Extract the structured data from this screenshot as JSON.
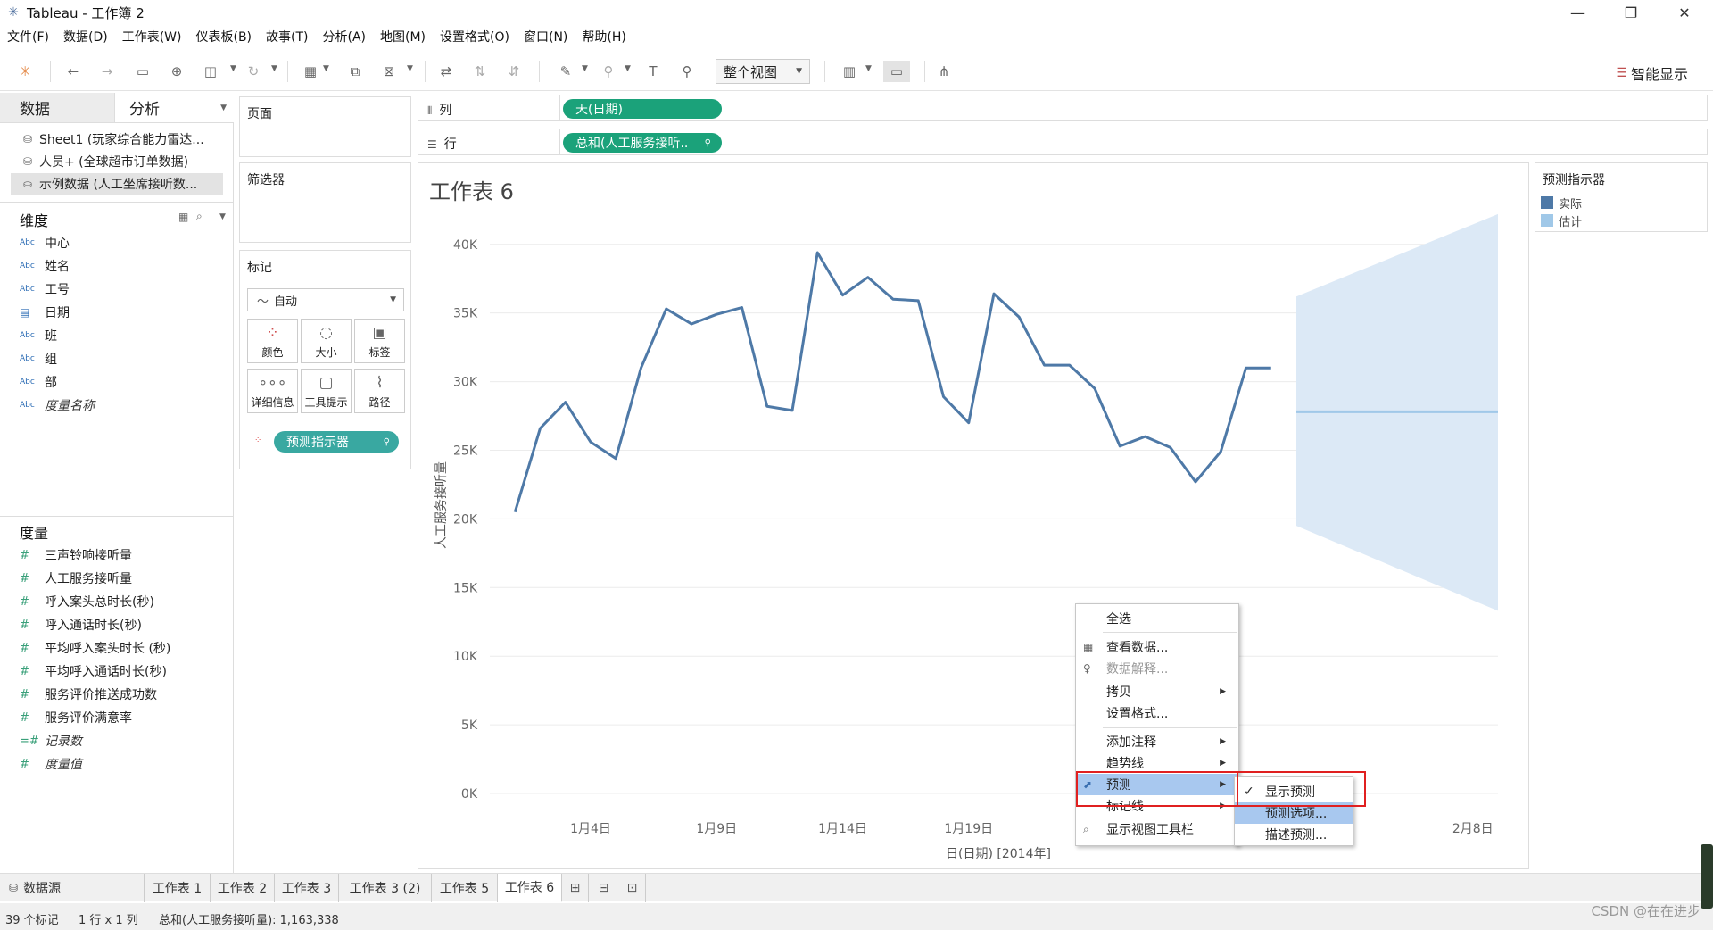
{
  "window": {
    "title": "Tableau - 工作簿 2",
    "min_label": "—",
    "max_label": "❐",
    "close_label": "✕"
  },
  "menu": [
    "文件(F)",
    "数据(D)",
    "工作表(W)",
    "仪表板(B)",
    "故事(T)",
    "分析(A)",
    "地图(M)",
    "设置格式(O)",
    "窗口(N)",
    "帮助(H)"
  ],
  "toolbar": {
    "fit_view": "整个视图",
    "show_me": "智能显示"
  },
  "data_pane": {
    "tab_data": "数据",
    "tab_analysis": "分析",
    "datasources": [
      "Sheet1 (玩家综合能力雷达...",
      "人员+ (全球超市订单数据)",
      "示例数据 (人工坐席接听数..."
    ],
    "dimensions_header": "维度",
    "dimensions": [
      {
        "icon": "Abc",
        "name": "中心"
      },
      {
        "icon": "Abc",
        "name": "姓名"
      },
      {
        "icon": "Abc",
        "name": "工号"
      },
      {
        "icon": "cal",
        "name": "日期"
      },
      {
        "icon": "Abc",
        "name": "班"
      },
      {
        "icon": "Abc",
        "name": "组"
      },
      {
        "icon": "Abc",
        "name": "部"
      },
      {
        "icon": "Abc",
        "name": "度量名称"
      }
    ],
    "measures_header": "度量",
    "measures": [
      "三声铃响接听量",
      "人工服务接听量",
      "呼入案头总时长(秒)",
      "呼入通话时长(秒)",
      "平均呼入案头时长 (秒)",
      "平均呼入通话时长(秒)",
      "服务评价推送成功数",
      "服务评价满意率",
      "记录数",
      "度量值"
    ]
  },
  "shelves": {
    "pages": "页面",
    "filters": "筛选器",
    "marks": "标记",
    "marks_type": "自动",
    "mark_buttons": [
      "颜色",
      "大小",
      "标签",
      "详细信息",
      "工具提示",
      "路径"
    ],
    "marks_pill": "预测指示器",
    "columns_label": "列",
    "columns_pill": "天(日期)",
    "rows_label": "行",
    "rows_pill": "总和(人工服务接听.."
  },
  "sheet": {
    "title": "工作表 6"
  },
  "chart_data": {
    "type": "line",
    "xlabel": "日(日期) [2014年]",
    "ylabel": "人工服务接听量",
    "ylim": [
      0,
      42000
    ],
    "yticks": [
      "0K",
      "5K",
      "10K",
      "15K",
      "20K",
      "25K",
      "30K",
      "35K",
      "40K"
    ],
    "xticks": [
      "1月4日",
      "1月9日",
      "1月14日",
      "1月19日",
      "2月8日"
    ],
    "xtick_positions": [
      4,
      9,
      14,
      19,
      39
    ],
    "x_range": [
      0,
      40
    ],
    "series": [
      {
        "name": "实际",
        "color": "#4e79a7",
        "x": [
          1,
          2,
          3,
          4,
          5,
          6,
          7,
          8,
          9,
          10,
          11,
          12,
          13,
          14,
          15,
          16,
          17,
          18,
          19,
          20,
          21,
          22,
          23,
          24,
          25,
          26,
          27,
          28,
          29,
          30,
          31
        ],
        "values": [
          20500,
          26600,
          28500,
          25600,
          24400,
          31000,
          35300,
          34200,
          34900,
          35400,
          28200,
          27900,
          39400,
          36300,
          37600,
          36000,
          35900,
          28900,
          27000,
          36400,
          34700,
          31200,
          31200,
          29500,
          25300,
          26000,
          25200,
          22700,
          24900,
          31000,
          31000
        ]
      }
    ],
    "forecast": {
      "name": "估计",
      "color": "#a0c8e8",
      "x_start": 32,
      "x_end": 40,
      "estimate": 27800,
      "upper_start": 36200,
      "upper_end": 42200,
      "lower_start": 19500,
      "lower_end": 13300
    },
    "legend": {
      "title": "预测指示器",
      "items": [
        {
          "label": "实际",
          "color": "#4e79a7"
        },
        {
          "label": "估计",
          "color": "#a0c8e8"
        }
      ]
    }
  },
  "context_menu": {
    "items": [
      "全选",
      "查看数据...",
      "数据解释...",
      "拷贝",
      "设置格式...",
      "添加注释",
      "趋势线",
      "预测",
      "标记线",
      "显示视图工具栏"
    ],
    "submenu": [
      "显示预测",
      "预测选项...",
      "描述预测..."
    ]
  },
  "sheet_tabs": {
    "datasource": "数据源",
    "tabs": [
      "工作表 1",
      "工作表 2",
      "工作表 3",
      "工作表 3 (2)",
      "工作表 5",
      "工作表 6"
    ],
    "active": "工作表 6"
  },
  "status": {
    "marks": "39 个标记",
    "dims": "1 行 x 1 列",
    "sum": "总和(人工服务接听量): 1,163,338"
  },
  "watermark": "CSDN @在在进步"
}
